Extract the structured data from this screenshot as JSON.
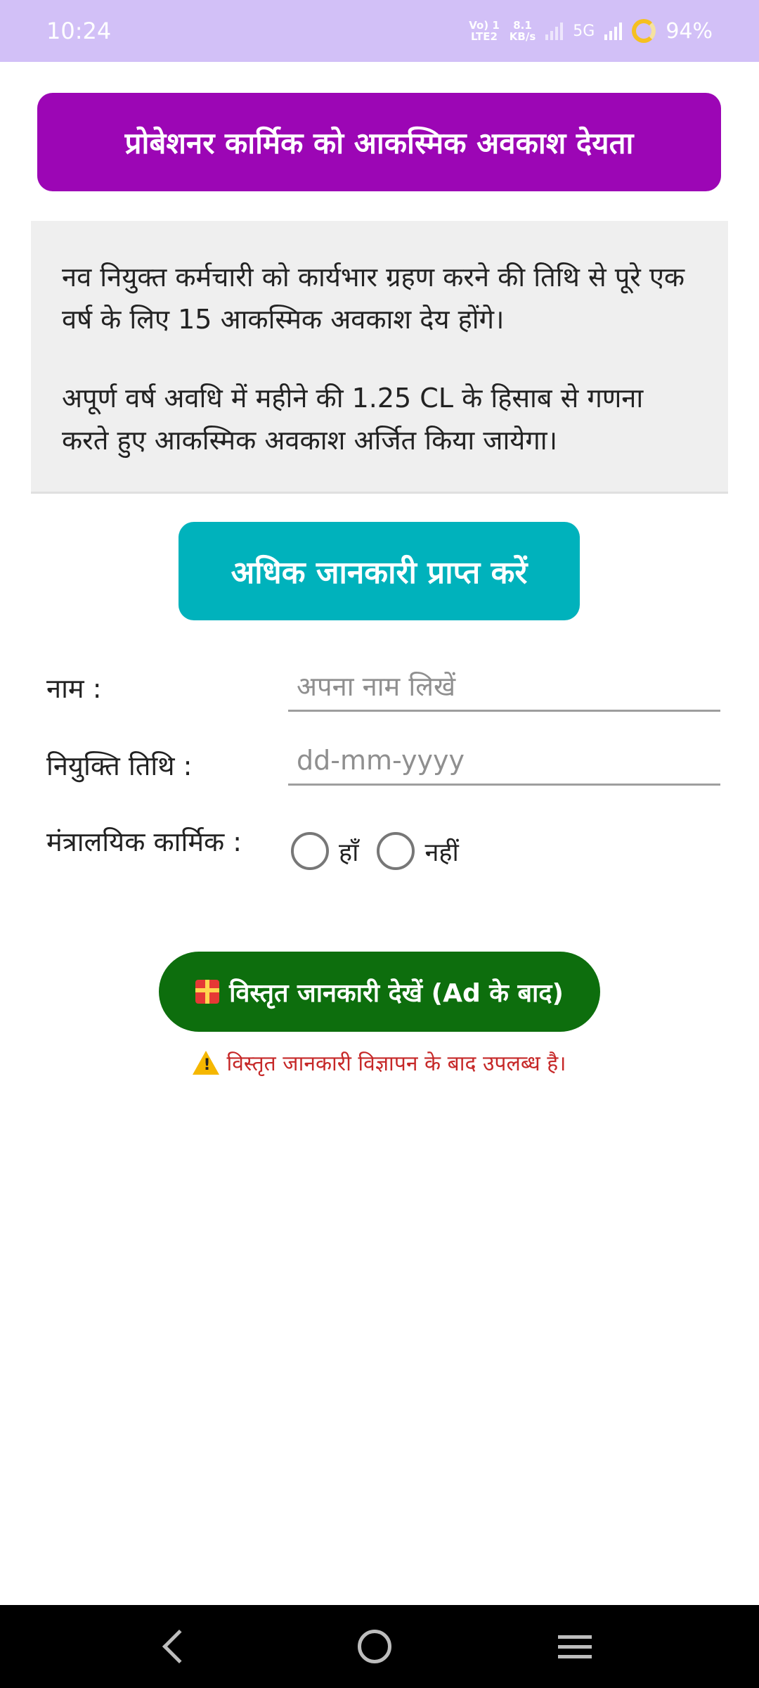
{
  "status_bar": {
    "time": "10:24",
    "net_top": "Vo) 1",
    "net_bottom": "LTE2",
    "speed_value": "8.1",
    "speed_unit": "KB/s",
    "network_type": "5G",
    "battery": "94%"
  },
  "header": {
    "title": "प्रोबेशनर कार्मिक को आकस्मिक अवकाश देयता"
  },
  "info": {
    "paragraph1": "नव नियुक्त कर्मचारी को कार्यभार ग्रहण करने की तिथि से पूरे एक वर्ष के लिए 15 आकस्मिक अवकाश देय होंगे।",
    "paragraph2": "अपूर्ण वर्ष अवधि में महीने की 1.25 CL के हिसाब से गणना करते हुए आकस्मिक अवकाश अर्जित किया जायेगा।"
  },
  "more_info_button": "अधिक जानकारी प्राप्त करें",
  "form": {
    "name_label": "नाम :",
    "name_placeholder": "अपना नाम लिखें",
    "name_value": "",
    "date_label": "नियुक्ति तिथि :",
    "date_placeholder": "dd-mm-yyyy",
    "date_value": "",
    "ministerial_label": "मंत्रालयिक कार्मिक :",
    "option_yes": "हाँ",
    "option_no": "नहीं"
  },
  "detail_button": "विस्तृत जानकारी देखें (Ad के बाद)",
  "warning": "विस्तृत जानकारी विज्ञापन के बाद उपलब्ध है।",
  "colors": {
    "status_bar": "#d2c0f7",
    "header": "#9c06b5",
    "more_info": "#00b2bc",
    "detail_button": "#0d6e0d",
    "warning": "#c62828"
  }
}
